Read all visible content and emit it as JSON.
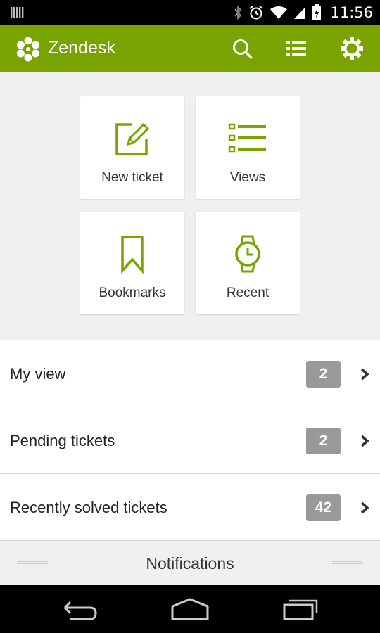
{
  "status_bar": {
    "time": "11:56",
    "icons": [
      "signal-bars-icon",
      "bluetooth-icon",
      "alarm-icon",
      "wifi-icon",
      "cell-signal-icon",
      "battery-charging-icon"
    ]
  },
  "app_bar": {
    "title": "Zendesk",
    "color": "#78a300",
    "actions": [
      "search-icon",
      "list-icon",
      "gear-icon"
    ]
  },
  "tiles": [
    {
      "label": "New ticket",
      "icon": "new-ticket-icon"
    },
    {
      "label": "Views",
      "icon": "views-list-icon"
    },
    {
      "label": "Bookmarks",
      "icon": "bookmark-icon"
    },
    {
      "label": "Recent",
      "icon": "watch-icon"
    }
  ],
  "list": [
    {
      "label": "My view",
      "count": "2"
    },
    {
      "label": "Pending tickets",
      "count": "2"
    },
    {
      "label": "Recently solved tickets",
      "count": "42"
    }
  ],
  "notifications": {
    "title": "Notifications"
  },
  "nav_bar": {
    "buttons": [
      "back-icon",
      "home-icon",
      "recent-apps-icon"
    ]
  }
}
